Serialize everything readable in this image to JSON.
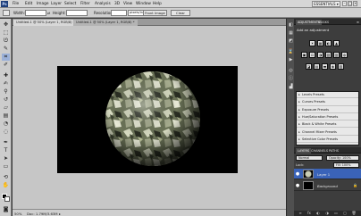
{
  "app": {
    "logo": "Ps"
  },
  "menubar": {
    "items": [
      "File",
      "Edit",
      "Image",
      "Layer",
      "Select",
      "Filter",
      "Analysis",
      "3D",
      "View",
      "Window",
      "Help"
    ],
    "workspace": "ESSENTIALS ▾",
    "window_buttons": [
      "–",
      "□",
      "×"
    ]
  },
  "options": {
    "width_label": "Width:",
    "height_label": "Height:",
    "resolution_label": "Resolution:",
    "resolution_unit": "pixels/inch",
    "front_image_button": "Front Image",
    "clear_button": "Clear"
  },
  "document": {
    "tabs": [
      "Untitled-1 @ 50% (Layer 1, RGB/8) *",
      "Untitled-1 @ 50% (Layer 1, RGB/8) *"
    ],
    "zoom": "50%",
    "doc_info": "Doc: 1.79M/3.63M"
  },
  "adjustments": {
    "tabs": [
      "ADJUSTMENTS",
      "MASKS"
    ],
    "title": "Add an adjustment",
    "icon_rows": [
      [
        "☀",
        "▦",
        "◐",
        "▲"
      ],
      [
        "▣",
        "⚖",
        "◑",
        "▧",
        "▥",
        "◍"
      ],
      [
        "◪",
        "▤",
        "▬",
        "◈",
        "▨"
      ]
    ],
    "presets": [
      "Levels Presets",
      "Curves Presets",
      "Exposure Presets",
      "Hue/Saturation Presets",
      "Black & White Presets",
      "Channel Mixer Presets",
      "Selective Color Presets"
    ]
  },
  "layers": {
    "tabs": [
      "LAYERS",
      "CHANNELS",
      "PATHS"
    ],
    "blend_mode": "Normal",
    "opacity": "Opacity: 100%",
    "lock_label": "Lock:",
    "fill": "Fill: 100%",
    "items": [
      {
        "name": "Layer 1",
        "selected": true
      },
      {
        "name": "Background",
        "selected": false
      }
    ],
    "bottom_icons": [
      "∞",
      "fx",
      "◐",
      "◑",
      "▭",
      "▢",
      "🗑"
    ]
  },
  "colors": {
    "canvas": "#000000",
    "workspace_bg": "#c6c6c6",
    "layer_selected": "#3a63b8"
  }
}
